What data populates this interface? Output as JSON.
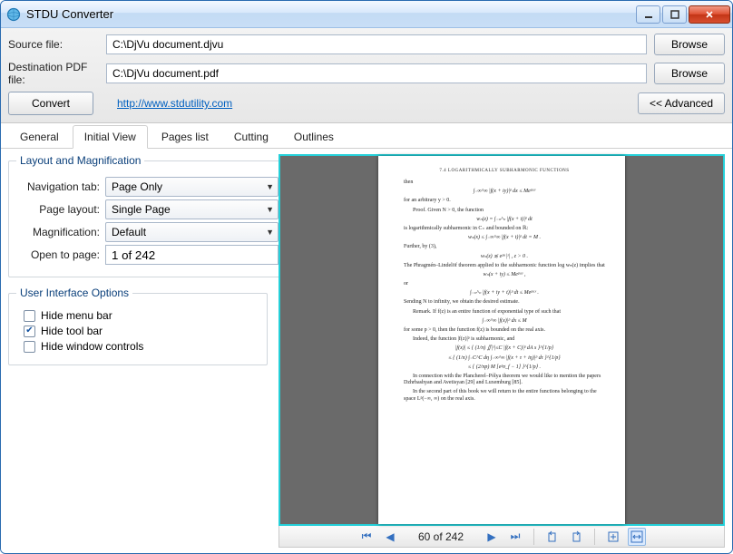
{
  "window": {
    "title": "STDU Converter"
  },
  "fields": {
    "source_label": "Source file:",
    "source_value": "C:\\DjVu document.djvu",
    "dest_label": "Destination PDF file:",
    "dest_value": "C:\\DjVu document.pdf",
    "browse": "Browse",
    "convert": "Convert",
    "advanced": "<< Advanced",
    "link": "http://www.stdutility.com"
  },
  "tabs": {
    "general": "General",
    "initial_view": "Initial View",
    "pages_list": "Pages list",
    "cutting": "Cutting",
    "outlines": "Outlines"
  },
  "layout_group": {
    "legend": "Layout and Magnification",
    "nav_tab_label": "Navigation tab:",
    "nav_tab_value": "Page Only",
    "page_layout_label": "Page layout:",
    "page_layout_value": "Single Page",
    "magnification_label": "Magnification:",
    "magnification_value": "Default",
    "open_to_page_label": "Open to page:",
    "open_to_page_value": "1 of 242"
  },
  "ui_group": {
    "legend": "User Interface Options",
    "hide_menu": "Hide menu bar",
    "hide_tool": "Hide tool bar",
    "hide_window": "Hide window controls",
    "hide_menu_checked": false,
    "hide_tool_checked": true,
    "hide_window_checked": false
  },
  "viewer": {
    "page_status": "60 of 242"
  },
  "doc": {
    "header": "7.4   LOGARITHMICALLY SUBHARMONIC FUNCTIONS",
    "l1": "then",
    "e1": "∫₋∞^∞ |f(x + iy)|ᵖ dx ≤ Meᵖᵃʸ",
    "l2": "for an arbitrary y > 0.",
    "l3": "Proof. Given N > 0, the function",
    "e2": "wₙ(z) = ∫₋ₙ^ₙ |f(x + t)|ᵖ dt",
    "l4": "is logarithmically subharmonic in C₊ and bounded on ℝ:",
    "e3": "wₙ(x) ≤ ∫₋∞^∞ |f(x + t)|ᵖ dt = M .",
    "l5": "Further, by (3),",
    "e4": "wₙ(z) ≲ eᵖᵃ|ᶻ| ,   z > 0 .",
    "l6": "The Phragmén–Lindelöf theorem applied to the subharmonic function log wₙ(z) implies that",
    "e5": "wₙ(x + iy) ≤ Meᵖᵃʸ ,",
    "l7": "or",
    "e6": "∫₋ₙ^ₙ |f(x + iy + t)|ᵖ dt ≤ Meᵖᵃʸ .",
    "l8": "Sending N to infinity, we obtain the desired estimate.",
    "l9": "Remark. If f(z) is an entire function of exponential type σf such that",
    "e7": "∫₋∞^∞ |f(x)|ᵖ dx ≤ M",
    "l10": "for some p > 0, then the function f(z) is bounded on the real axis.",
    "l11": "Indeed, the function |f(z)|ᵖ is subharmonic, and",
    "e8": "|f(x)| ≤ { (1/π) ∬|ᶻ|≤C |f(x + C)|ᵖ dA s }^{1/p}",
    "e9": "≤ { (1/π) ∫₋C^C dη ∫₋∞^∞ |f(x + τ + iη)|ᵖ dτ }^{1/p}",
    "e10": "≤ { (2/πp) M [eᵖσ_f − 1] }^{1/p} .",
    "l12": "In connection with the Plancherel–Pólya theorem we would like to mention the papers Dzhrbashyan and Avetisyan [29] and Luxemburg [85].",
    "l13": "In the second part of this book we will return to the entire functions belonging to the space Lᵖ(−∞, ∞) on the real axis."
  }
}
